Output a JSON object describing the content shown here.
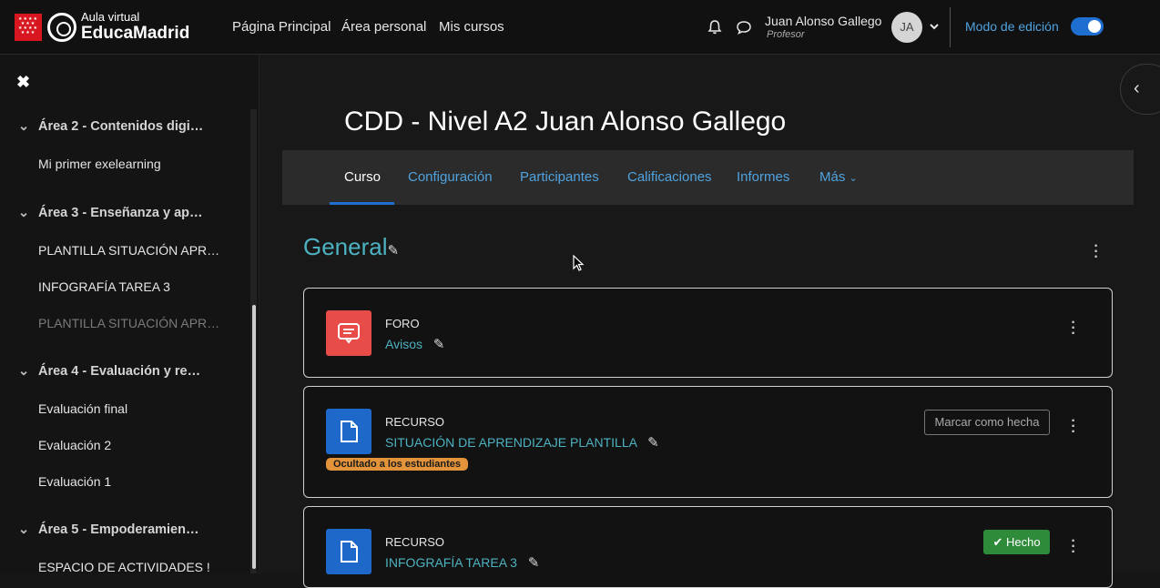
{
  "header": {
    "logo_small": "Aula virtual",
    "logo_big": "EducaMadrid",
    "nav": [
      "Página Principal",
      "Área personal",
      "Mis cursos"
    ],
    "user_name": "Juan Alonso Gallego",
    "user_role": "Profesor",
    "avatar_initials": "JA",
    "edit_mode_label": "Modo de edición",
    "edit_mode_on": true
  },
  "sidebar": {
    "close_glyph": "✖",
    "items": [
      {
        "type": "section",
        "label": "Área 2 - Contenidos digi…"
      },
      {
        "type": "item",
        "label": "Mi primer exelearning"
      },
      {
        "type": "section",
        "label": "Área 3 - Enseñanza y ap…"
      },
      {
        "type": "item",
        "label": "PLANTILLA SITUACIÓN APR…"
      },
      {
        "type": "item",
        "label": "INFOGRAFÍA TAREA 3"
      },
      {
        "type": "item",
        "label": "PLANTILLA SITUACIÓN APR…",
        "dim": true
      },
      {
        "type": "section",
        "label": "Área 4 - Evaluación y re…"
      },
      {
        "type": "item",
        "label": "Evaluación final"
      },
      {
        "type": "item",
        "label": "Evaluación 2"
      },
      {
        "type": "item",
        "label": "Evaluación 1"
      },
      {
        "type": "section",
        "label": "Área 5 - Empoderamien…"
      },
      {
        "type": "item",
        "label": "ESPACIO DE ACTIVIDADES !"
      }
    ]
  },
  "course": {
    "title": "CDD - Nivel A2 Juan Alonso Gallego",
    "tabs": [
      "Curso",
      "Configuración",
      "Participantes",
      "Calificaciones",
      "Informes",
      "Más"
    ],
    "active_tab": "Curso",
    "section_title": "General"
  },
  "activities": [
    {
      "type": "FORO",
      "name": "Avisos",
      "icon": "forum-icon",
      "color": "#e74c48"
    },
    {
      "type": "RECURSO",
      "name": "SITUACIÓN DE APRENDIZAJE PLANTILLA",
      "icon": "file-icon",
      "color": "#1d68c8",
      "badge": "Ocultado a los estudiantes",
      "action": "Marcar como hecha"
    },
    {
      "type": "RECURSO",
      "name": "INFOGRAFÍA TAREA 3",
      "icon": "file-icon",
      "color": "#1d68c8",
      "action": "Hecho"
    }
  ],
  "colors": {
    "accent": "#1f6fd0",
    "link": "#4db2c1",
    "brand_red": "#d7161f",
    "done": "#2e8b3a",
    "hidden_badge": "#e3933a"
  }
}
